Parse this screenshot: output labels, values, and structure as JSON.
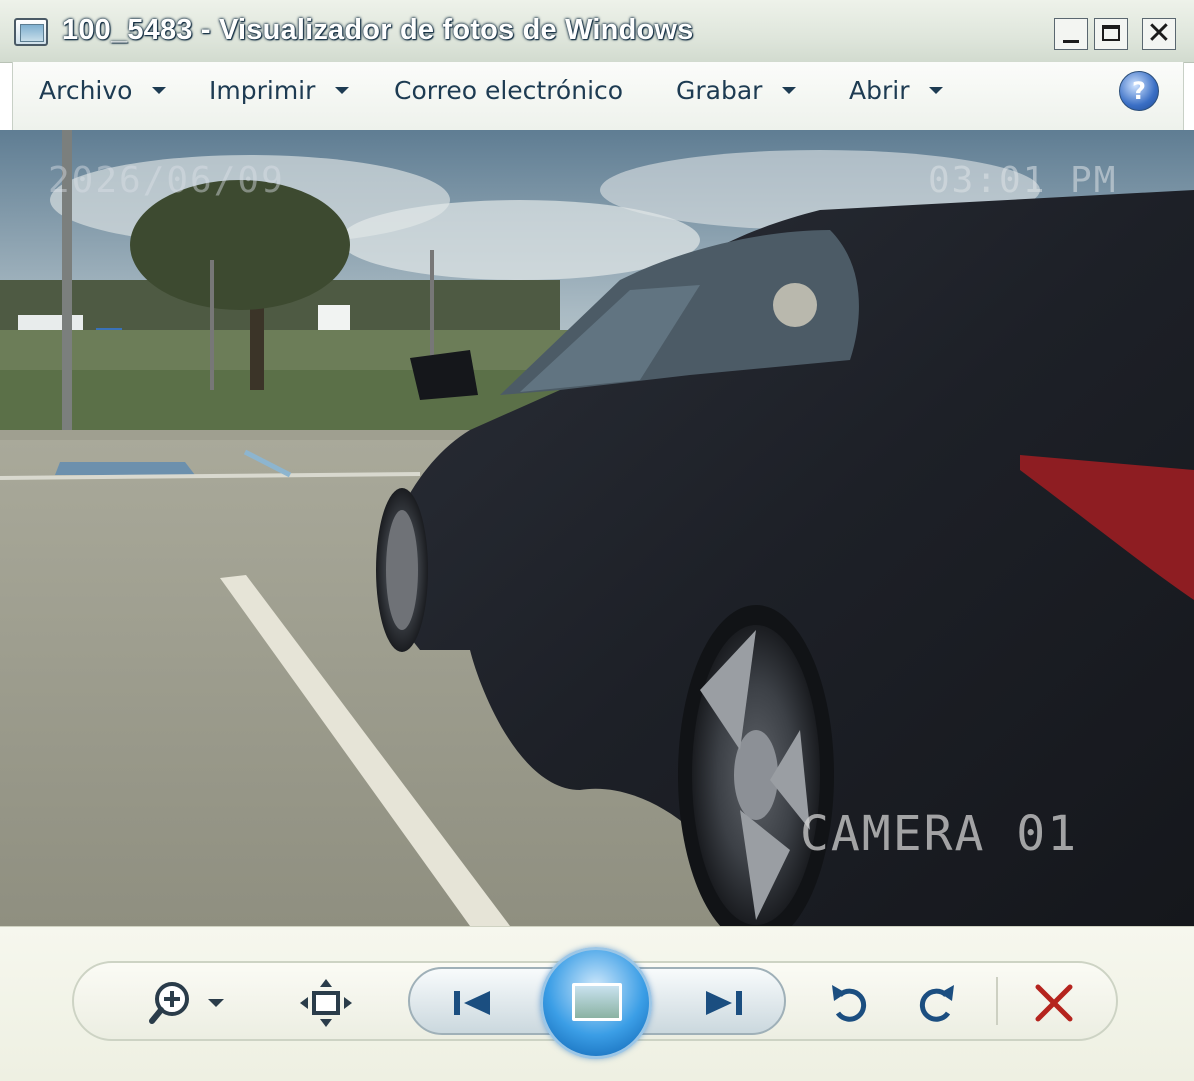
{
  "window": {
    "title": "100_5483 - Visualizador de fotos de Windows",
    "controls": {
      "minimize": "_",
      "maximize": "□",
      "close": "✕"
    }
  },
  "menu": {
    "items": [
      {
        "label": "Archivo",
        "has_dropdown": true
      },
      {
        "label": "Imprimir",
        "has_dropdown": true
      },
      {
        "label": "Correo electrónico",
        "has_dropdown": false
      },
      {
        "label": "Grabar",
        "has_dropdown": true
      },
      {
        "label": "Abrir",
        "has_dropdown": true
      }
    ],
    "help_icon": "?"
  },
  "photo": {
    "overlay_date": "2026/06/09",
    "overlay_time": "03:01 PM",
    "overlay_camera": "CAMERA 01",
    "description_icons": "parking-lot-car-photo"
  },
  "toolbar": {
    "icons": [
      "zoom-icon",
      "fit-to-window-icon",
      "previous-icon",
      "slideshow-icon",
      "next-icon",
      "rotate-left-icon",
      "rotate-right-icon",
      "delete-icon"
    ]
  },
  "colors": {
    "title_text": "#ffffff",
    "menu_text": "#1d3b52",
    "delete_red": "#b5241e",
    "play_blue": "#1f7fd1"
  }
}
